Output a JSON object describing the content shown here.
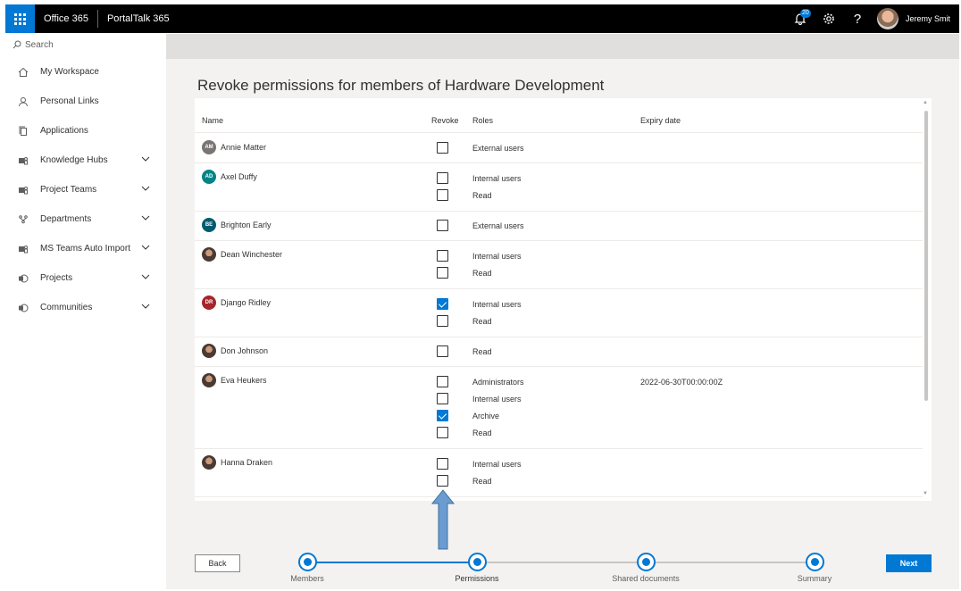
{
  "topbar": {
    "brand": "Office 365",
    "app": "PortalTalk 365",
    "notifications_count": "20",
    "help": "?",
    "user_name": "Jeremy Smit",
    "accent": "#0078d4"
  },
  "sidebar": {
    "search_placeholder": "Search",
    "items": [
      {
        "label": "My Workspace",
        "icon": "home-icon",
        "expandable": false
      },
      {
        "label": "Personal Links",
        "icon": "person-icon",
        "expandable": false
      },
      {
        "label": "Applications",
        "icon": "copy-icon",
        "expandable": false
      },
      {
        "label": "Knowledge Hubs",
        "icon": "teams-icon",
        "expandable": true
      },
      {
        "label": "Project Teams",
        "icon": "teams-icon",
        "expandable": true
      },
      {
        "label": "Departments",
        "icon": "org-icon",
        "expandable": true
      },
      {
        "label": "MS Teams Auto Import",
        "icon": "teams-icon",
        "expandable": true
      },
      {
        "label": "Projects",
        "icon": "sharepoint-icon",
        "expandable": true
      },
      {
        "label": "Communities",
        "icon": "sharepoint-icon",
        "expandable": true
      }
    ]
  },
  "page": {
    "title": "Revoke permissions for members of Hardware Development"
  },
  "table": {
    "columns": {
      "name": "Name",
      "revoke": "Revoke",
      "roles": "Roles",
      "expiry": "Expiry date"
    },
    "members": [
      {
        "name": "Annie Matter",
        "initials": "AM",
        "avatar_color": "#7a7574",
        "photo": false,
        "roles": [
          {
            "role": "External users",
            "checked": false,
            "expiry": ""
          }
        ]
      },
      {
        "name": "Axel Duffy",
        "initials": "AD",
        "avatar_color": "#038387",
        "photo": false,
        "roles": [
          {
            "role": "Internal users",
            "checked": false,
            "expiry": ""
          },
          {
            "role": "Read",
            "checked": false,
            "expiry": ""
          }
        ]
      },
      {
        "name": "Brighton Early",
        "initials": "BE",
        "avatar_color": "#005b70",
        "photo": false,
        "roles": [
          {
            "role": "External users",
            "checked": false,
            "expiry": ""
          }
        ]
      },
      {
        "name": "Dean Winchester",
        "initials": "",
        "avatar_color": "#3b3a39",
        "photo": true,
        "roles": [
          {
            "role": "Internal users",
            "checked": false,
            "expiry": ""
          },
          {
            "role": "Read",
            "checked": false,
            "expiry": ""
          }
        ]
      },
      {
        "name": "Django Ridley",
        "initials": "DR",
        "avatar_color": "#a4262c",
        "photo": false,
        "roles": [
          {
            "role": "Internal users",
            "checked": true,
            "expiry": ""
          },
          {
            "role": "Read",
            "checked": false,
            "expiry": ""
          }
        ]
      },
      {
        "name": "Don Johnson",
        "initials": "",
        "avatar_color": "#4a3a33",
        "photo": true,
        "roles": [
          {
            "role": "Read",
            "checked": false,
            "expiry": ""
          }
        ]
      },
      {
        "name": "Eva Heukers",
        "initials": "",
        "avatar_color": "#8a5a3c",
        "photo": true,
        "roles": [
          {
            "role": "Administrators",
            "checked": false,
            "expiry": "2022-06-30T00:00:00Z"
          },
          {
            "role": "Internal users",
            "checked": false,
            "expiry": ""
          },
          {
            "role": "Archive",
            "checked": true,
            "expiry": ""
          },
          {
            "role": "Read",
            "checked": false,
            "expiry": ""
          }
        ]
      },
      {
        "name": "Hanna Draken",
        "initials": "",
        "avatar_color": "#3b3a39",
        "photo": true,
        "roles": [
          {
            "role": "Internal users",
            "checked": false,
            "expiry": ""
          },
          {
            "role": "Read",
            "checked": false,
            "expiry": ""
          }
        ]
      }
    ]
  },
  "footer": {
    "back_label": "Back",
    "next_label": "Next",
    "steps": [
      "Members",
      "Permissions",
      "Shared documents",
      "Summary"
    ],
    "active_step": 1
  }
}
